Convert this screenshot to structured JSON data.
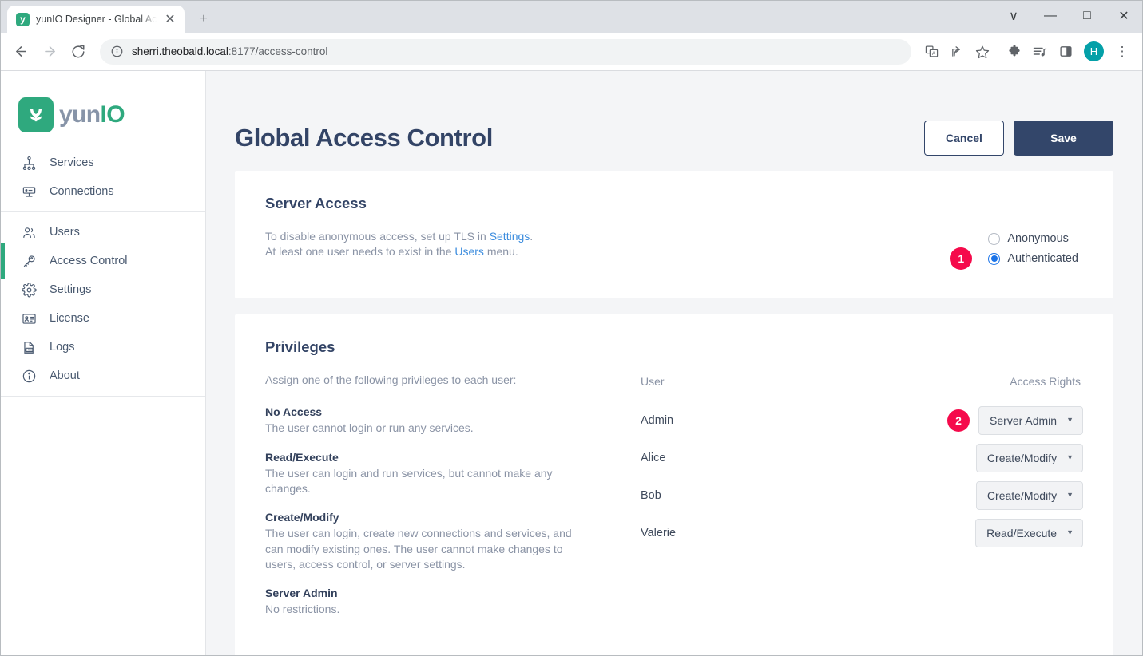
{
  "browser": {
    "tab": {
      "title": "yunIO Designer - Global Access C",
      "favicon_letter": "y",
      "favicon_name": "yunio-favicon",
      "close_label": "✕"
    },
    "new_tab_label": "+",
    "window_controls": {
      "more": "∨",
      "minimize": "—",
      "maximize": "□",
      "close": "✕"
    },
    "nav": {
      "back": "←",
      "forward": "→",
      "reload": "⟳"
    },
    "omnibox": {
      "site_info_icon": "ⓘ",
      "url_main": "sherri.theobald.local",
      "url_rest": ":8177/access-control"
    },
    "toolbar_icons": [
      {
        "name": "translate-icon",
        "glyph": "文"
      },
      {
        "name": "share-icon",
        "glyph": "↱"
      },
      {
        "name": "bookmark-star-icon",
        "glyph": "☆"
      },
      {
        "name": "extensions-puzzle-icon",
        "glyph": "❖"
      },
      {
        "name": "reading-list-icon",
        "glyph": "♫"
      },
      {
        "name": "side-panel-icon",
        "glyph": "▣"
      }
    ],
    "profile_avatar_letter": "H",
    "menu_icon": "⋮"
  },
  "sidebar": {
    "logo": {
      "mark_letter": "y",
      "text_a": "yun",
      "text_b": "IO"
    },
    "groups": [
      {
        "items": [
          {
            "label": "Services",
            "icon": "services-sitemap-icon",
            "active": false
          },
          {
            "label": "Connections",
            "icon": "connections-server-icon",
            "active": false
          }
        ]
      },
      {
        "items": [
          {
            "label": "Users",
            "icon": "users-people-icon",
            "active": false
          },
          {
            "label": "Access Control",
            "icon": "access-control-key-icon",
            "active": true
          },
          {
            "label": "Settings",
            "icon": "settings-gear-icon",
            "active": false
          },
          {
            "label": "License",
            "icon": "license-card-icon",
            "active": false
          },
          {
            "label": "Logs",
            "icon": "logs-document-icon",
            "active": false
          },
          {
            "label": "About",
            "icon": "about-info-icon",
            "active": false
          }
        ]
      }
    ]
  },
  "header": {
    "title": "Global Access Control",
    "cancel_label": "Cancel",
    "save_label": "Save"
  },
  "server_access": {
    "title": "Server Access",
    "desc_line1_a": "To disable anonymous access, set up TLS in ",
    "desc_line1_link": "Settings",
    "desc_line1_b": ".",
    "desc_line2_a": "At least one user needs to exist in the ",
    "desc_line2_link": "Users",
    "desc_line2_b": " menu.",
    "options": [
      {
        "label": "Anonymous",
        "checked": false
      },
      {
        "label": "Authenticated",
        "checked": true
      }
    ],
    "badge": "1"
  },
  "privileges": {
    "title": "Privileges",
    "intro": "Assign one of the following privileges to each user:",
    "entries": [
      {
        "name": "No Access",
        "desc": "The user cannot login or run any services."
      },
      {
        "name": "Read/Execute",
        "desc": "The user can login and run services, but cannot make any changes."
      },
      {
        "name": "Create/Modify",
        "desc": "The user can login, create new connections and services, and can modify existing ones. The user cannot make changes to users, access control, or server settings."
      },
      {
        "name": "Server Admin",
        "desc": "No restrictions."
      }
    ],
    "table": {
      "columns": [
        "User",
        "Access Rights"
      ],
      "rows": [
        {
          "user": "Admin",
          "rights": "Server Admin",
          "badge": "2"
        },
        {
          "user": "Alice",
          "rights": "Create/Modify",
          "badge": ""
        },
        {
          "user": "Bob",
          "rights": "Create/Modify",
          "badge": ""
        },
        {
          "user": "Valerie",
          "rights": "Read/Execute",
          "badge": ""
        }
      ]
    },
    "caret_glyph": "▼"
  },
  "colors": {
    "brand_green": "#2fa97e",
    "navy": "#33466a",
    "link_blue": "#3d8dde",
    "radio_blue": "#1a73e8",
    "badge_red": "#f50a4b",
    "muted_text": "#8a93a5"
  }
}
